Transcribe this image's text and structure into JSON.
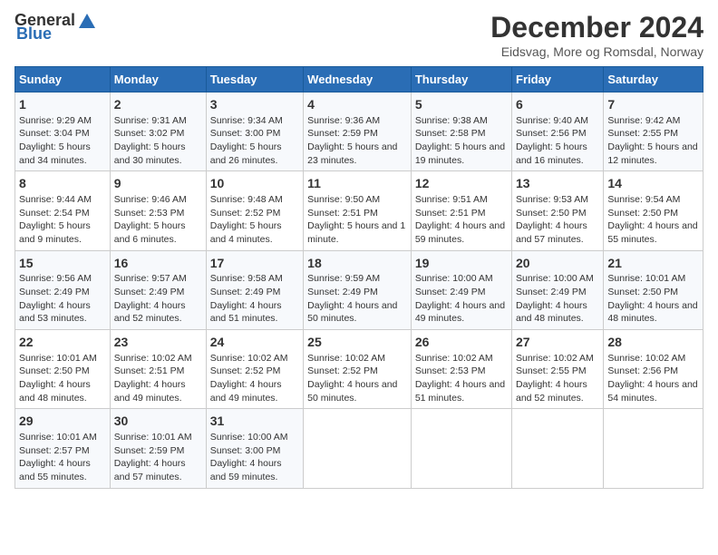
{
  "header": {
    "logo_general": "General",
    "logo_blue": "Blue",
    "title": "December 2024",
    "subtitle": "Eidsvag, More og Romsdal, Norway"
  },
  "calendar": {
    "days_of_week": [
      "Sunday",
      "Monday",
      "Tuesday",
      "Wednesday",
      "Thursday",
      "Friday",
      "Saturday"
    ],
    "weeks": [
      [
        {
          "day": "1",
          "sunrise": "Sunrise: 9:29 AM",
          "sunset": "Sunset: 3:04 PM",
          "daylight": "Daylight: 5 hours and 34 minutes."
        },
        {
          "day": "2",
          "sunrise": "Sunrise: 9:31 AM",
          "sunset": "Sunset: 3:02 PM",
          "daylight": "Daylight: 5 hours and 30 minutes."
        },
        {
          "day": "3",
          "sunrise": "Sunrise: 9:34 AM",
          "sunset": "Sunset: 3:00 PM",
          "daylight": "Daylight: 5 hours and 26 minutes."
        },
        {
          "day": "4",
          "sunrise": "Sunrise: 9:36 AM",
          "sunset": "Sunset: 2:59 PM",
          "daylight": "Daylight: 5 hours and 23 minutes."
        },
        {
          "day": "5",
          "sunrise": "Sunrise: 9:38 AM",
          "sunset": "Sunset: 2:58 PM",
          "daylight": "Daylight: 5 hours and 19 minutes."
        },
        {
          "day": "6",
          "sunrise": "Sunrise: 9:40 AM",
          "sunset": "Sunset: 2:56 PM",
          "daylight": "Daylight: 5 hours and 16 minutes."
        },
        {
          "day": "7",
          "sunrise": "Sunrise: 9:42 AM",
          "sunset": "Sunset: 2:55 PM",
          "daylight": "Daylight: 5 hours and 12 minutes."
        }
      ],
      [
        {
          "day": "8",
          "sunrise": "Sunrise: 9:44 AM",
          "sunset": "Sunset: 2:54 PM",
          "daylight": "Daylight: 5 hours and 9 minutes."
        },
        {
          "day": "9",
          "sunrise": "Sunrise: 9:46 AM",
          "sunset": "Sunset: 2:53 PM",
          "daylight": "Daylight: 5 hours and 6 minutes."
        },
        {
          "day": "10",
          "sunrise": "Sunrise: 9:48 AM",
          "sunset": "Sunset: 2:52 PM",
          "daylight": "Daylight: 5 hours and 4 minutes."
        },
        {
          "day": "11",
          "sunrise": "Sunrise: 9:50 AM",
          "sunset": "Sunset: 2:51 PM",
          "daylight": "Daylight: 5 hours and 1 minute."
        },
        {
          "day": "12",
          "sunrise": "Sunrise: 9:51 AM",
          "sunset": "Sunset: 2:51 PM",
          "daylight": "Daylight: 4 hours and 59 minutes."
        },
        {
          "day": "13",
          "sunrise": "Sunrise: 9:53 AM",
          "sunset": "Sunset: 2:50 PM",
          "daylight": "Daylight: 4 hours and 57 minutes."
        },
        {
          "day": "14",
          "sunrise": "Sunrise: 9:54 AM",
          "sunset": "Sunset: 2:50 PM",
          "daylight": "Daylight: 4 hours and 55 minutes."
        }
      ],
      [
        {
          "day": "15",
          "sunrise": "Sunrise: 9:56 AM",
          "sunset": "Sunset: 2:49 PM",
          "daylight": "Daylight: 4 hours and 53 minutes."
        },
        {
          "day": "16",
          "sunrise": "Sunrise: 9:57 AM",
          "sunset": "Sunset: 2:49 PM",
          "daylight": "Daylight: 4 hours and 52 minutes."
        },
        {
          "day": "17",
          "sunrise": "Sunrise: 9:58 AM",
          "sunset": "Sunset: 2:49 PM",
          "daylight": "Daylight: 4 hours and 51 minutes."
        },
        {
          "day": "18",
          "sunrise": "Sunrise: 9:59 AM",
          "sunset": "Sunset: 2:49 PM",
          "daylight": "Daylight: 4 hours and 50 minutes."
        },
        {
          "day": "19",
          "sunrise": "Sunrise: 10:00 AM",
          "sunset": "Sunset: 2:49 PM",
          "daylight": "Daylight: 4 hours and 49 minutes."
        },
        {
          "day": "20",
          "sunrise": "Sunrise: 10:00 AM",
          "sunset": "Sunset: 2:49 PM",
          "daylight": "Daylight: 4 hours and 48 minutes."
        },
        {
          "day": "21",
          "sunrise": "Sunrise: 10:01 AM",
          "sunset": "Sunset: 2:50 PM",
          "daylight": "Daylight: 4 hours and 48 minutes."
        }
      ],
      [
        {
          "day": "22",
          "sunrise": "Sunrise: 10:01 AM",
          "sunset": "Sunset: 2:50 PM",
          "daylight": "Daylight: 4 hours and 48 minutes."
        },
        {
          "day": "23",
          "sunrise": "Sunrise: 10:02 AM",
          "sunset": "Sunset: 2:51 PM",
          "daylight": "Daylight: 4 hours and 49 minutes."
        },
        {
          "day": "24",
          "sunrise": "Sunrise: 10:02 AM",
          "sunset": "Sunset: 2:52 PM",
          "daylight": "Daylight: 4 hours and 49 minutes."
        },
        {
          "day": "25",
          "sunrise": "Sunrise: 10:02 AM",
          "sunset": "Sunset: 2:52 PM",
          "daylight": "Daylight: 4 hours and 50 minutes."
        },
        {
          "day": "26",
          "sunrise": "Sunrise: 10:02 AM",
          "sunset": "Sunset: 2:53 PM",
          "daylight": "Daylight: 4 hours and 51 minutes."
        },
        {
          "day": "27",
          "sunrise": "Sunrise: 10:02 AM",
          "sunset": "Sunset: 2:55 PM",
          "daylight": "Daylight: 4 hours and 52 minutes."
        },
        {
          "day": "28",
          "sunrise": "Sunrise: 10:02 AM",
          "sunset": "Sunset: 2:56 PM",
          "daylight": "Daylight: 4 hours and 54 minutes."
        }
      ],
      [
        {
          "day": "29",
          "sunrise": "Sunrise: 10:01 AM",
          "sunset": "Sunset: 2:57 PM",
          "daylight": "Daylight: 4 hours and 55 minutes."
        },
        {
          "day": "30",
          "sunrise": "Sunrise: 10:01 AM",
          "sunset": "Sunset: 2:59 PM",
          "daylight": "Daylight: 4 hours and 57 minutes."
        },
        {
          "day": "31",
          "sunrise": "Sunrise: 10:00 AM",
          "sunset": "Sunset: 3:00 PM",
          "daylight": "Daylight: 4 hours and 59 minutes."
        },
        null,
        null,
        null,
        null
      ]
    ]
  }
}
